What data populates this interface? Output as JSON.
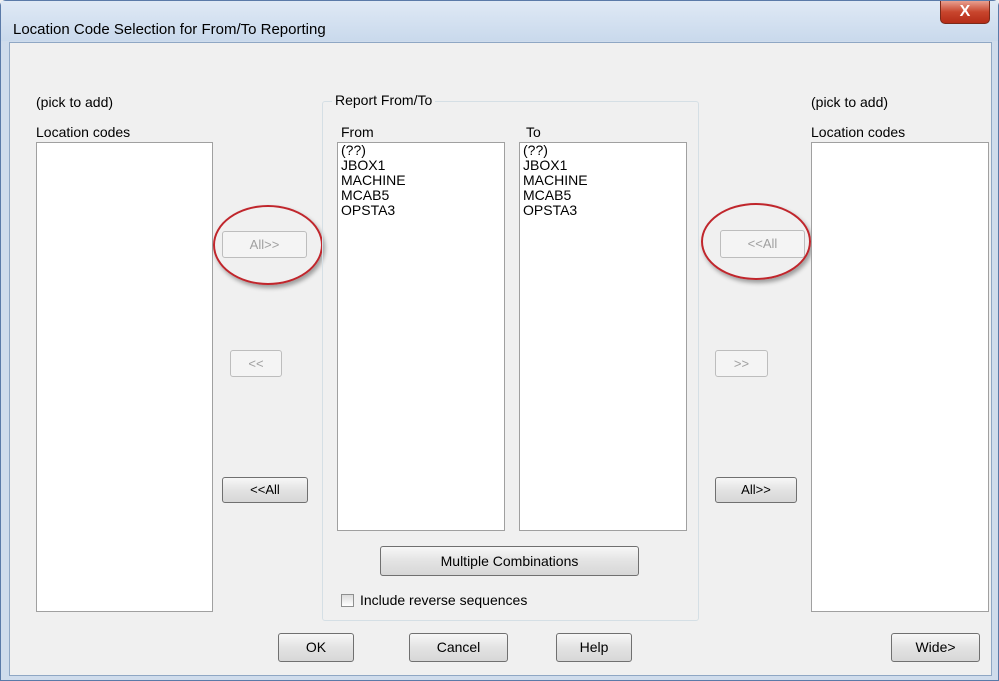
{
  "window": {
    "title": "Location Code Selection for From/To Reporting",
    "close_label": "X"
  },
  "left_panel": {
    "hint": "(pick to add)",
    "header": "Location codes",
    "items": []
  },
  "right_panel": {
    "hint": "(pick to add)",
    "header": "Location codes",
    "items": []
  },
  "report_group": {
    "legend": "Report From/To",
    "from_header": "From",
    "to_header": "To",
    "from_items": [
      "(??)",
      "JBOX1",
      "MACHINE",
      "MCAB5",
      "OPSTA3"
    ],
    "to_items": [
      "(??)",
      "JBOX1",
      "MACHINE",
      "MCAB5",
      "OPSTA3"
    ],
    "multiple_combinations_label": "Multiple Combinations",
    "include_reverse_label": "Include reverse sequences",
    "include_reverse_checked": false
  },
  "left_buttons": {
    "add_all": "All>>",
    "remove_one": "<<",
    "remove_all": "<<All"
  },
  "right_buttons": {
    "add_all": "<<All",
    "remove_one": ">>",
    "remove_all": "All>>"
  },
  "footer": {
    "ok": "OK",
    "cancel": "Cancel",
    "help": "Help",
    "wide": "Wide>"
  },
  "colors": {
    "annotation_circle": "#c0262c",
    "close_button": "#c8452d"
  }
}
